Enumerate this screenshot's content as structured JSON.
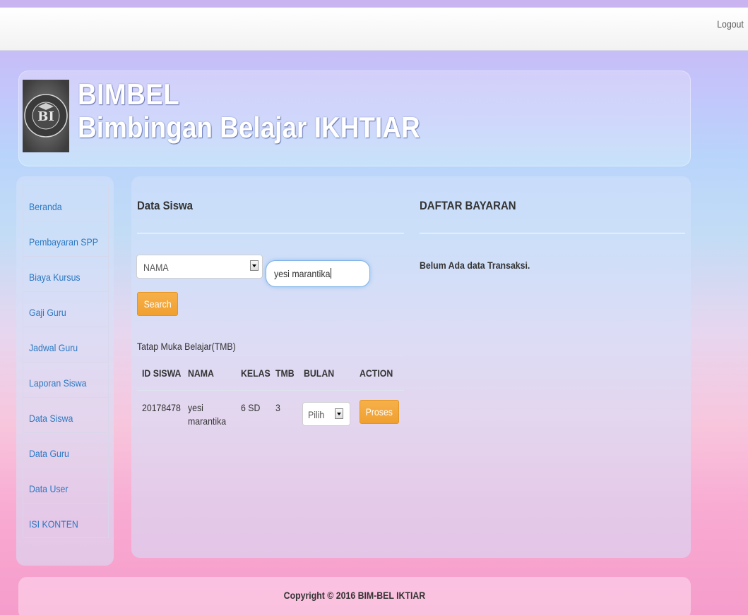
{
  "topbar": {
    "logout_label": "Logout"
  },
  "header": {
    "brand_line1": "BIMBEL",
    "brand_line2": "Bimbingan Belajar IKHTIAR",
    "logo": {
      "initials": "BI",
      "ring_text": "BIMBINGAN BELAJAR IKHTIAR"
    }
  },
  "sidebar": {
    "items": [
      {
        "label": "Beranda",
        "name": "sidebar-item-beranda"
      },
      {
        "label": "Pembayaran SPP",
        "name": "sidebar-item-pembayaran-spp"
      },
      {
        "label": "Biaya Kursus",
        "name": "sidebar-item-biaya-kursus"
      },
      {
        "label": "Gaji Guru",
        "name": "sidebar-item-gaji-guru"
      },
      {
        "label": "Jadwal Guru",
        "name": "sidebar-item-jadwal-guru"
      },
      {
        "label": "Laporan Siswa",
        "name": "sidebar-item-laporan-siswa"
      },
      {
        "label": "Data Siswa",
        "name": "sidebar-item-data-siswa"
      },
      {
        "label": "Data Guru",
        "name": "sidebar-item-data-guru"
      },
      {
        "label": "Data User",
        "name": "sidebar-item-data-user"
      },
      {
        "label": "ISI KONTEN",
        "name": "sidebar-item-isi-konten"
      }
    ]
  },
  "data_siswa": {
    "title": "Data Siswa",
    "search": {
      "field_select": "NAMA",
      "query": "yesi marantika",
      "button_label": "Search"
    },
    "table_caption": "Tatap Muka Belajar(TMB)",
    "columns": [
      "ID SISWA",
      "NAMA",
      "KELAS",
      "TMB",
      "BULAN",
      "ACTION"
    ],
    "rows": [
      {
        "id_siswa": "20178478",
        "nama_line1": "yesi",
        "nama_line2": "marantika",
        "kelas": "6 SD",
        "tmb": "3",
        "bulan": "Pilih",
        "action_label": "Proses"
      }
    ]
  },
  "daftar_bayaran": {
    "title": "DAFTAR BAYARAN",
    "empty_message": "Belum Ada data Transaksi."
  },
  "footer": {
    "copyright": "Copyright © 2016 BIM-BEL IKTIAR"
  },
  "colors": {
    "accent_orange": "#f0a030",
    "link_blue": "#2b78c2"
  }
}
